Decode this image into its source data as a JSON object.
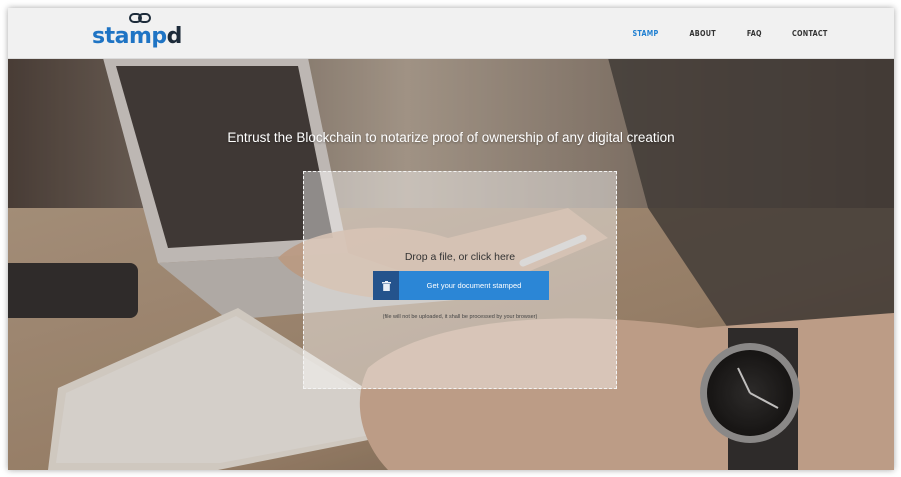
{
  "header": {
    "logo_text": "stampd",
    "nav": [
      {
        "label": "STAMP",
        "active": true
      },
      {
        "label": "ABOUT",
        "active": false
      },
      {
        "label": "FAQ",
        "active": false
      },
      {
        "label": "CONTACT",
        "active": false
      }
    ]
  },
  "hero": {
    "tagline": "Entrust the Blockchain to notarize proof of ownership of any digital creation",
    "dropzone": {
      "drop_text": "Drop a file, or click here",
      "button_label": "Get your document stamped",
      "button_icon": "trash-icon",
      "note": "(file will not be uploaded, it shall be processed by your browser)"
    }
  },
  "colors": {
    "accent": "#2b86d6",
    "accent_dark": "#24538c",
    "nav_active": "#1f7fd1",
    "logo_blue": "#1f74c4"
  }
}
